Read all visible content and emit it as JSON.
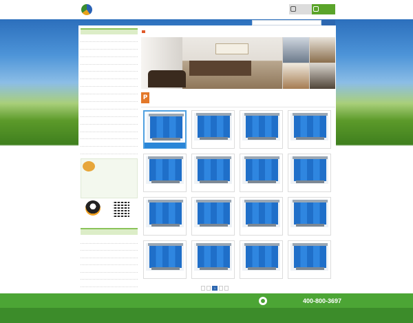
{
  "header": {
    "logo_name": "",
    "logo_url": "",
    "nav": [
      "",
      "",
      "",
      "",
      "",
      "",
      ""
    ],
    "fav_button": "",
    "follow_button": ""
  },
  "search": {
    "placeholder": ""
  },
  "sidebar": {
    "category_title": "",
    "categories": [
      "",
      "",
      "",
      "",
      "",
      "",
      "",
      "",
      "",
      "",
      "",
      "",
      "",
      "",
      "",
      "",
      ""
    ],
    "contact": {
      "tel": "",
      "person": "",
      "lines": [
        "",
        "",
        "",
        "",
        ""
      ]
    },
    "qq_label": "",
    "qr_label": "",
    "news_title": "",
    "news": [
      "",
      "",
      "",
      "",
      "",
      "",
      ""
    ]
  },
  "breadcrumb": "",
  "products_section": {
    "badge": "P",
    "title": "",
    "desc": ""
  },
  "products": [
    {
      "name": "",
      "active": true
    },
    {
      "name": "",
      "active": false
    },
    {
      "name": "",
      "active": false
    },
    {
      "name": "",
      "active": false
    },
    {
      "name": "",
      "active": false
    },
    {
      "name": "",
      "active": false
    },
    {
      "name": "",
      "active": false
    },
    {
      "name": "",
      "active": false
    },
    {
      "name": "",
      "active": false
    },
    {
      "name": "",
      "active": false
    },
    {
      "name": "",
      "active": false
    },
    {
      "name": "",
      "active": false
    },
    {
      "name": "",
      "active": false
    },
    {
      "name": "",
      "active": false
    },
    {
      "name": "",
      "active": false
    },
    {
      "name": "",
      "active": false
    }
  ],
  "pager": {
    "info": "",
    "first": "",
    "prev": "",
    "current": "1",
    "next": "",
    "last": ""
  },
  "footer": {
    "nav": [
      "",
      "",
      "",
      "",
      "",
      "",
      ""
    ],
    "hotline_label": "",
    "hotline": "400-800-3697",
    "line1": "",
    "line2": ""
  },
  "colors": {
    "brand_green": "#4ca535",
    "brand_blue": "#2d67b0",
    "accent_orange": "#e3782a"
  }
}
